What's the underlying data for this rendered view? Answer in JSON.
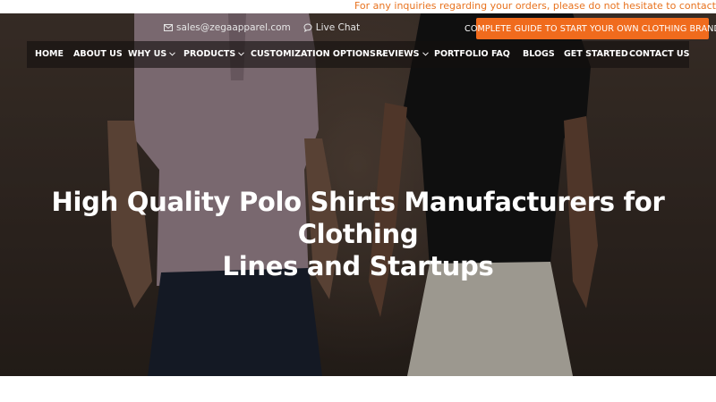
{
  "notice": {
    "text": "For any inquiries regarding your orders, please do not hesitate to contact"
  },
  "top_links": {
    "email": {
      "icon": "envelope-icon",
      "label": "sales@zegaapparel.com"
    },
    "chat": {
      "icon": "chat-bubble-icon",
      "label": "Live Chat"
    }
  },
  "cta": {
    "label": "COMPLETE GUIDE TO START YOUR OWN CLOTHING BRAND"
  },
  "nav": {
    "items": [
      {
        "label": "HOME",
        "dropdown": false
      },
      {
        "label": "ABOUT US",
        "dropdown": false
      },
      {
        "label": "WHY US",
        "dropdown": true
      },
      {
        "label": "PRODUCTS",
        "dropdown": true
      },
      {
        "label": "CUSTOMIZATION OPTIONS",
        "dropdown": true
      },
      {
        "label": "REVIEWS",
        "dropdown": true
      },
      {
        "label": "PORTFOLIO",
        "dropdown": false
      },
      {
        "label": "FAQ",
        "dropdown": false
      },
      {
        "label": "BLOGS",
        "dropdown": false
      },
      {
        "label": "GET STARTED",
        "dropdown": false
      },
      {
        "label": "CONTACT US",
        "dropdown": false
      }
    ]
  },
  "hero": {
    "title_line1": "High Quality Polo Shirts Manufacturers for Clothing",
    "title_line2": "Lines and Startups"
  },
  "colors": {
    "accent": "#f06b1d",
    "notice_text": "#e8731f",
    "nav_text": "#ffffff"
  }
}
